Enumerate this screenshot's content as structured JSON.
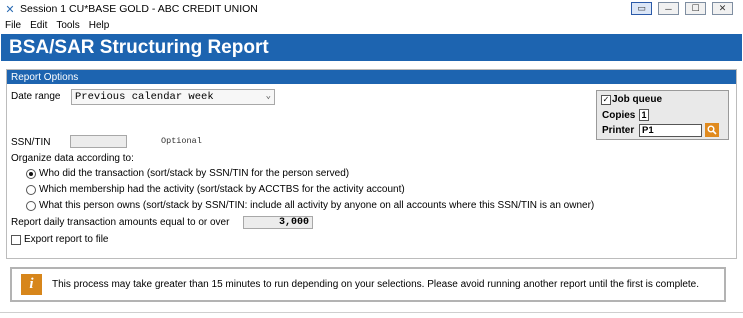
{
  "window": {
    "title": "Session 1 CU*BASE GOLD - ABC CREDIT UNION",
    "icon": "cu-base-icon"
  },
  "menu": [
    "File",
    "Edit",
    "Tools",
    "Help"
  ],
  "banner_title": "BSA/SAR Structuring Report",
  "panel_title": "Report Options",
  "date_range": {
    "label": "Date range",
    "value": "Previous calendar week"
  },
  "ssn": {
    "label": "SSN/TIN",
    "value": "",
    "hint": "Optional"
  },
  "organize_label": "Organize data according to:",
  "organize_options": [
    {
      "label": "Who did the transaction (sort/stack by SSN/TIN for the person served)",
      "checked": true
    },
    {
      "label": "Which membership had the activity (sort/stack by ACCTBS for the activity account)",
      "checked": false
    },
    {
      "label": "What this person owns (sort/stack by SSN/TIN: include all activity by anyone on all accounts where this SSN/TIN is an owner)",
      "checked": false
    }
  ],
  "amount": {
    "label": "Report daily transaction amounts equal to or over",
    "value": "3,000"
  },
  "export_label": "Export report to file",
  "job": {
    "job_queue_label": "Job queue",
    "job_queue_checked": true,
    "copies_label": "Copies",
    "copies_value": "1",
    "printer_label": "Printer",
    "printer_value": "P1"
  },
  "notice": {
    "text": "This process may take greater than 15 minutes to run depending on your selections. Please avoid running another report until the first is complete."
  },
  "colors": {
    "banner": "#1d64b0",
    "notice_icon": "#d7861b"
  }
}
